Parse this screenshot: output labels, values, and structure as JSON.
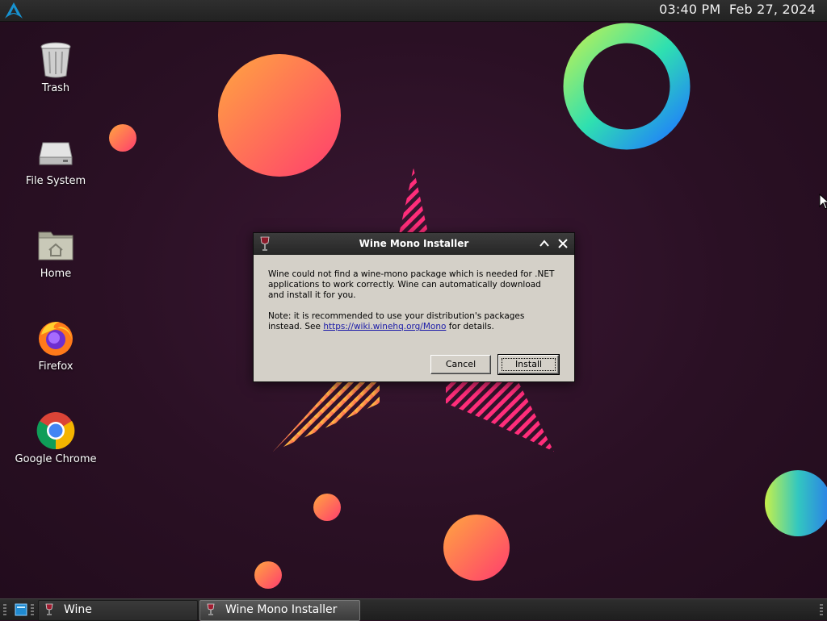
{
  "top_panel": {
    "logo_icon": "arch-linux-logo",
    "clock": "03:40 PM  Feb 27, 2024"
  },
  "desktop": {
    "icons": [
      {
        "label": "Trash",
        "icon": "trash-icon"
      },
      {
        "label": "File System",
        "icon": "drive-icon"
      },
      {
        "label": "Home",
        "icon": "home-folder-icon"
      },
      {
        "label": "Firefox",
        "icon": "firefox-icon"
      },
      {
        "label": "Google Chrome",
        "icon": "chrome-icon"
      }
    ]
  },
  "dialog": {
    "title": "Wine Mono Installer",
    "paragraph1": "Wine could not find a wine-mono package which is needed for .NET applications to work correctly. Wine can automatically download and install it for you.",
    "note_prefix": "Note: it is recommended to use your distribution's packages instead. See ",
    "link_text": "https://wiki.winehq.org/Mono",
    "note_suffix": " for details.",
    "cancel_label": "Cancel",
    "install_label": "Install"
  },
  "taskbar": {
    "tasks": [
      {
        "label": "Wine",
        "icon": "wine-glass-icon"
      },
      {
        "label": "Wine Mono Installer",
        "icon": "wine-glass-icon"
      }
    ]
  },
  "colors": {
    "background": "#2a1024",
    "dialog_face": "#d4d0c8",
    "link": "#1a1aa8"
  }
}
